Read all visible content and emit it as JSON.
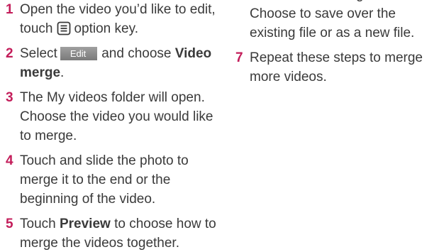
{
  "left_column": {
    "steps": [
      {
        "number": "1",
        "line1": "Open the video you’d like to edit,",
        "line2_before": "touch",
        "icon": "menu-icon",
        "line2_after": "option key."
      },
      {
        "number": "2",
        "before": "Select",
        "button_label": "Edit",
        "middle": "and choose",
        "bold_text": "Video merge",
        "after": "."
      },
      {
        "number": "3",
        "text": "The My videos folder will open. Choose the video you would like to merge."
      },
      {
        "number": "4",
        "text": "Touch and slide the photo to merge it to the end or the beginning of the video."
      },
      {
        "number": "5",
        "before": "Touch",
        "bold_text": "Preview",
        "after": "to choose how to merge the videos together."
      }
    ]
  },
  "right_column": {
    "steps": [
      {
        "number": "",
        "text": "save the new merged video. Choose to save over the existing file or as a new file."
      },
      {
        "number": "7",
        "text": "Repeat these steps to merge more videos."
      }
    ]
  },
  "colors": {
    "step_number": "#c31d5a",
    "body_text": "#3a3a3a",
    "edit_button_bg": "#8a8a8a"
  }
}
